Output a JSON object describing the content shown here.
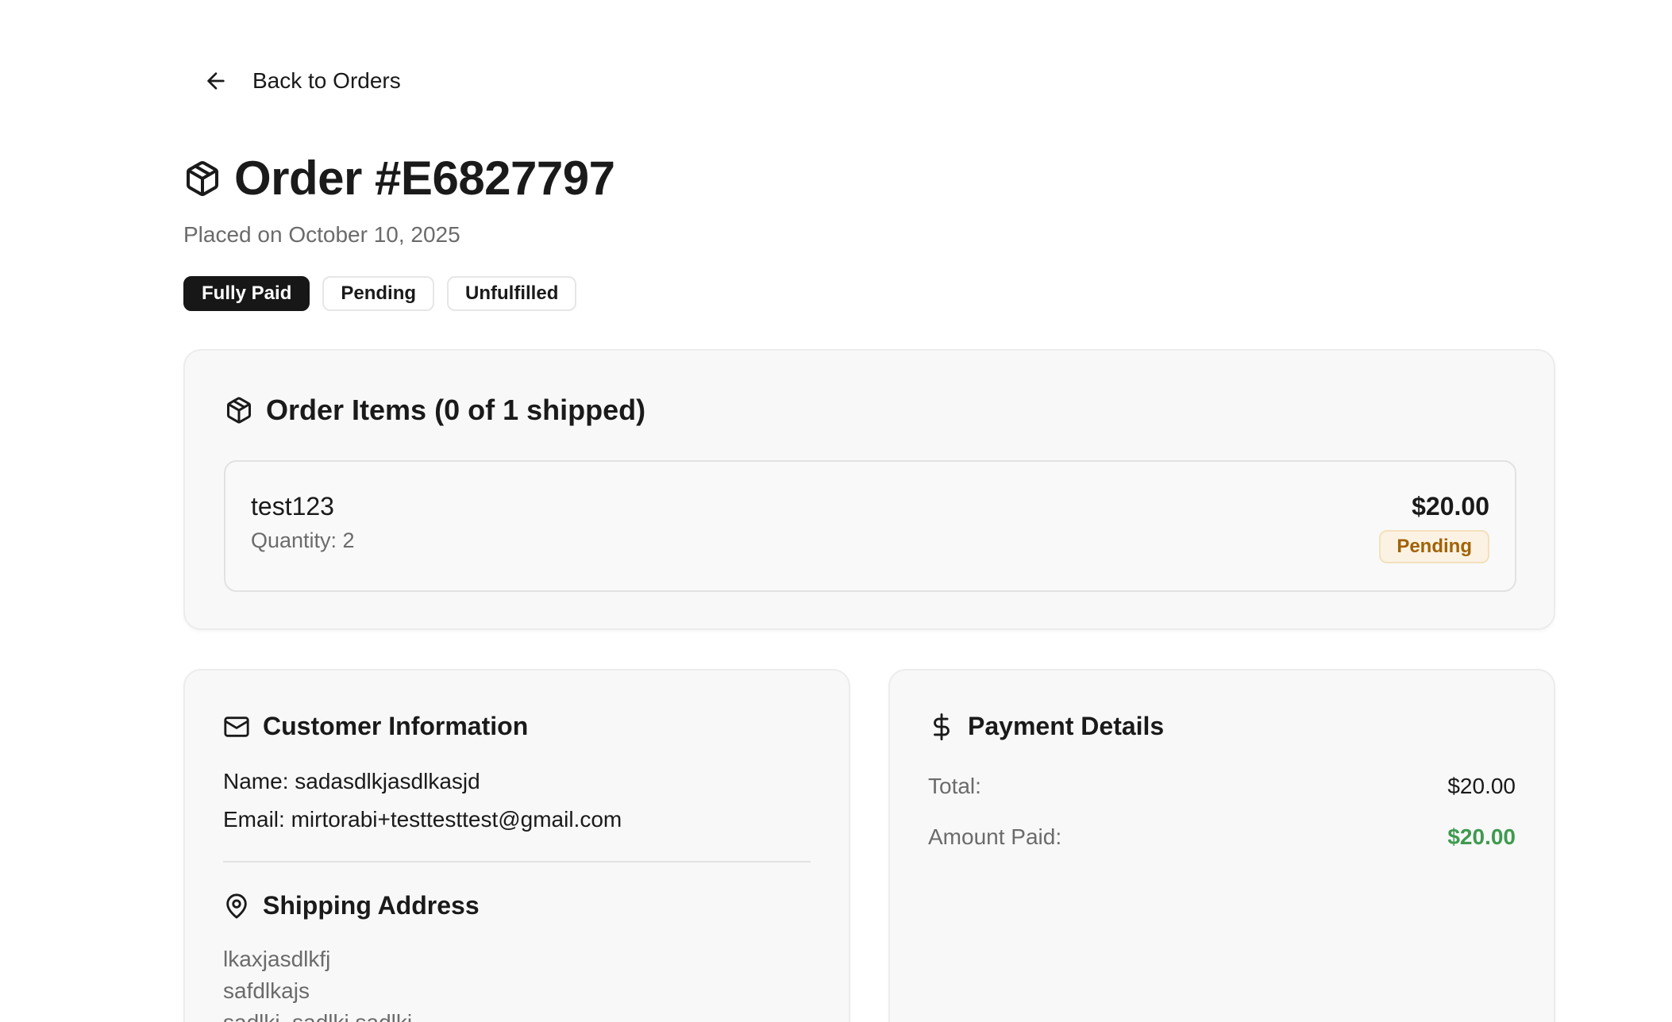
{
  "nav": {
    "back_label": "Back to Orders"
  },
  "header": {
    "title": "Order #E6827797",
    "placed": "Placed on October 10, 2025"
  },
  "badges": [
    {
      "label": "Fully Paid",
      "style": "dark"
    },
    {
      "label": "Pending",
      "style": "outline"
    },
    {
      "label": "Unfulfilled",
      "style": "outline"
    }
  ],
  "order_items": {
    "heading": "Order Items (0 of 1 shipped)",
    "items": [
      {
        "name": "test123",
        "quantity": "Quantity: 2",
        "price": "$20.00",
        "status": "Pending"
      }
    ]
  },
  "customer": {
    "heading": "Customer Information",
    "name": "Name: sadasdlkjasdlkasjd",
    "email": "Email: mirtorabi+testtesttest@gmail.com"
  },
  "shipping": {
    "heading": "Shipping Address",
    "lines": [
      "lkaxjasdlkfj",
      "safdlkajs",
      "sadlkj, sadlkj sadlkj"
    ]
  },
  "payment": {
    "heading": "Payment Details",
    "total_label": "Total:",
    "total_value": "$20.00",
    "paid_label": "Amount Paid:",
    "paid_value": "$20.00"
  },
  "colors": {
    "paid_green": "#3f9a4f",
    "pending_amber": "#a16207",
    "badge_dark": "#171717"
  }
}
